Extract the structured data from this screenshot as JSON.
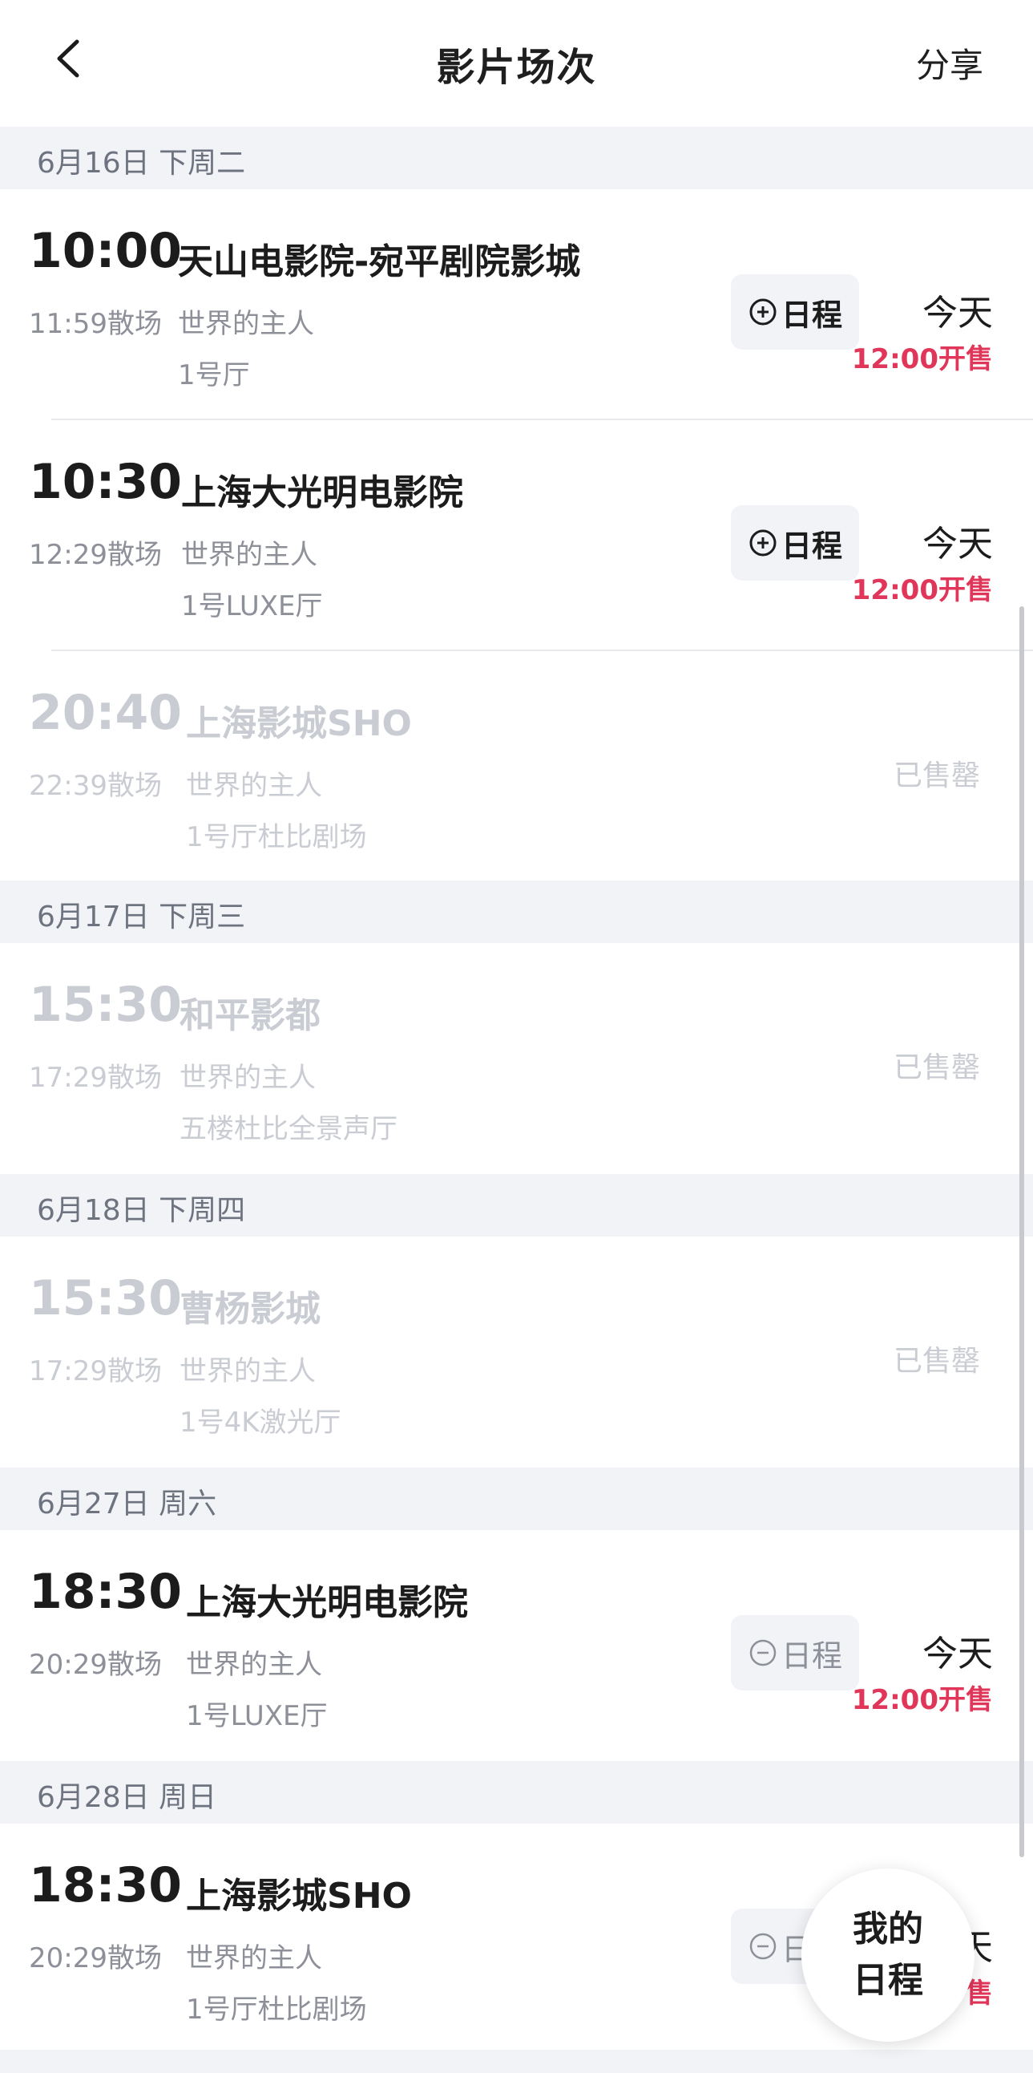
{
  "header": {
    "title": "影片场次",
    "share_label": "分享"
  },
  "groups": [
    {
      "date": "6月16日 下周二",
      "sessions": [
        {
          "time": "10:00",
          "cinema": "天山电影院-宛平剧院影城",
          "end": "11:59散场",
          "movie": "世界的主人",
          "hall": "1号厅",
          "status": "available",
          "schedule_label": "日程",
          "schedule_added": false,
          "today_label": "今天",
          "sale_label": "12:00开售"
        },
        {
          "time": "10:30",
          "cinema": "上海大光明电影院",
          "end": "12:29散场",
          "movie": "世界的主人",
          "hall": "1号LUXE厅",
          "status": "available",
          "schedule_label": "日程",
          "schedule_added": false,
          "today_label": "今天",
          "sale_label": "12:00开售"
        },
        {
          "time": "20:40",
          "cinema": "上海影城SHO",
          "end": "22:39散场",
          "movie": "世界的主人",
          "hall": "1号厅杜比剧场",
          "status": "soldout",
          "soldout_label": "已售罄"
        }
      ]
    },
    {
      "date": "6月17日 下周三",
      "sessions": [
        {
          "time": "15:30",
          "cinema": "和平影都",
          "end": "17:29散场",
          "movie": "世界的主人",
          "hall": "五楼杜比全景声厅",
          "status": "soldout",
          "soldout_label": "已售罄"
        }
      ]
    },
    {
      "date": "6月18日 下周四",
      "sessions": [
        {
          "time": "15:30",
          "cinema": "曹杨影城",
          "end": "17:29散场",
          "movie": "世界的主人",
          "hall": "1号4K激光厅",
          "status": "soldout",
          "soldout_label": "已售罄"
        }
      ]
    },
    {
      "date": "6月27日 周六",
      "sessions": [
        {
          "time": "18:30",
          "cinema": "上海大光明电影院",
          "end": "20:29散场",
          "movie": "世界的主人",
          "hall": "1号LUXE厅",
          "status": "available",
          "schedule_label": "日程",
          "schedule_added": true,
          "today_label": "今天",
          "sale_label": "12:00开售"
        }
      ]
    },
    {
      "date": "6月28日 周日",
      "sessions": [
        {
          "time": "18:30",
          "cinema": "上海影城SHO",
          "end": "20:29散场",
          "movie": "世界的主人",
          "hall": "1号厅杜比剧场",
          "status": "available",
          "schedule_label": "日程",
          "schedule_added": true,
          "today_label": "今天",
          "sale_label": "12:00开售"
        }
      ]
    }
  ],
  "fab": {
    "line1": "我的",
    "line2": "日程"
  },
  "colors": {
    "accent_red": "#e0365a",
    "section_bg": "#f1f3f7",
    "muted_text": "#8d9099",
    "disabled_text": "#c9ccd2"
  },
  "icons": {
    "back": "chevron-left-icon",
    "add_schedule": "plus-circle-icon",
    "remove_schedule": "minus-circle-icon"
  }
}
